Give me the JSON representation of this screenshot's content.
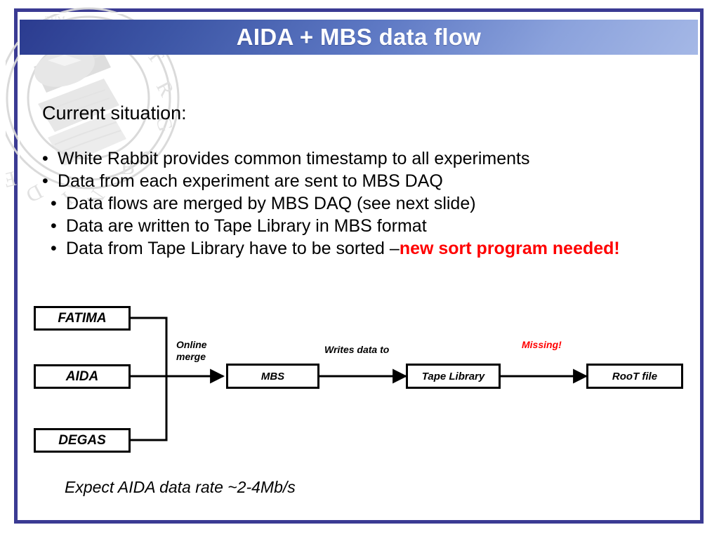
{
  "slide": {
    "title": "AIDA + MBS data flow",
    "lead": "Current situation:",
    "bullets": [
      {
        "marker": "•",
        "text": "White Rabbit provides common timestamp to all experiments"
      },
      {
        "marker": "•",
        "text": "Data from each experiment are sent to MBS DAQ"
      },
      {
        "marker": "•",
        "text": "Data flows are merged by MBS DAQ (see next slide)"
      },
      {
        "marker": "•",
        "text": "Data are written to Tape Library in MBS format"
      }
    ],
    "last_bullet": {
      "marker": "•",
      "text": "Data from Tape Library have to be sorted – ",
      "highlight": "new sort program needed!"
    },
    "caption": "Expect AIDA data rate ~2-4Mb/s"
  },
  "diagram": {
    "nodes": [
      {
        "id": "fatima",
        "label": "FATIMA"
      },
      {
        "id": "aida",
        "label": "AIDA"
      },
      {
        "id": "degas",
        "label": "DEGAS"
      },
      {
        "id": "mbs",
        "label": "MBS"
      },
      {
        "id": "tape",
        "label": "Tape Library"
      },
      {
        "id": "root",
        "label": "RooT file"
      }
    ],
    "edge_labels": [
      {
        "id": "online-merge",
        "text": "Online\nmerge"
      },
      {
        "id": "writes-data-to",
        "text": "Writes data to"
      },
      {
        "id": "missing",
        "text": "Missing!"
      }
    ]
  },
  "colors": {
    "frame": "#3b3b93",
    "title_gradient_start": "#2b3b8f",
    "title_gradient_end": "#a5b8e6",
    "alert": "#ff0000",
    "text": "#000000"
  }
}
